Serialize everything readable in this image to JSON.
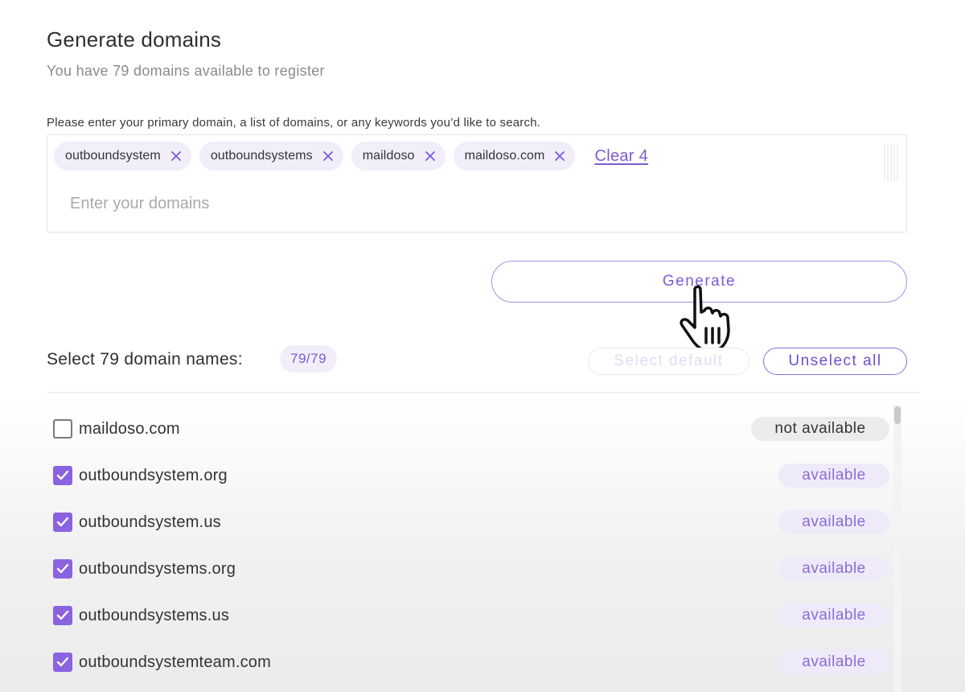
{
  "header": {
    "title": "Generate domains",
    "subtitle": "You have 79 domains available to register"
  },
  "instruction": "Please enter your primary domain, a list of domains, or any keywords you’d like to search.",
  "chips": [
    {
      "label": "outboundsystem"
    },
    {
      "label": "outboundsystems"
    },
    {
      "label": "maildoso"
    },
    {
      "label": "maildoso.com"
    }
  ],
  "clear_link": "Clear 4",
  "domain_input": {
    "value": "",
    "placeholder": "Enter your domains"
  },
  "generate_button": "Generate",
  "selection": {
    "label": "Select 79 domain names:",
    "count": "79/79",
    "select_default_label": "Select default",
    "unselect_all_label": "Unselect all"
  },
  "domains": [
    {
      "name": "maildoso.com",
      "checked": false,
      "status": "not available"
    },
    {
      "name": "outboundsystem.org",
      "checked": true,
      "status": "available"
    },
    {
      "name": "outboundsystem.us",
      "checked": true,
      "status": "available"
    },
    {
      "name": "outboundsystems.org",
      "checked": true,
      "status": "available"
    },
    {
      "name": "outboundsystems.us",
      "checked": true,
      "status": "available"
    },
    {
      "name": "outboundsystemteam.com",
      "checked": true,
      "status": "available"
    }
  ],
  "icons": {
    "chip_remove": "close-icon",
    "checkbox": "checkmark-icon",
    "cursor": "hand-pointer-icon"
  },
  "colors": {
    "accent": "#7b5cd6",
    "checkbox_checked": "#8a63e0",
    "chip_bg": "#f1eefa",
    "available_bg": "#efeaf9",
    "not_available_bg": "#ececec"
  }
}
